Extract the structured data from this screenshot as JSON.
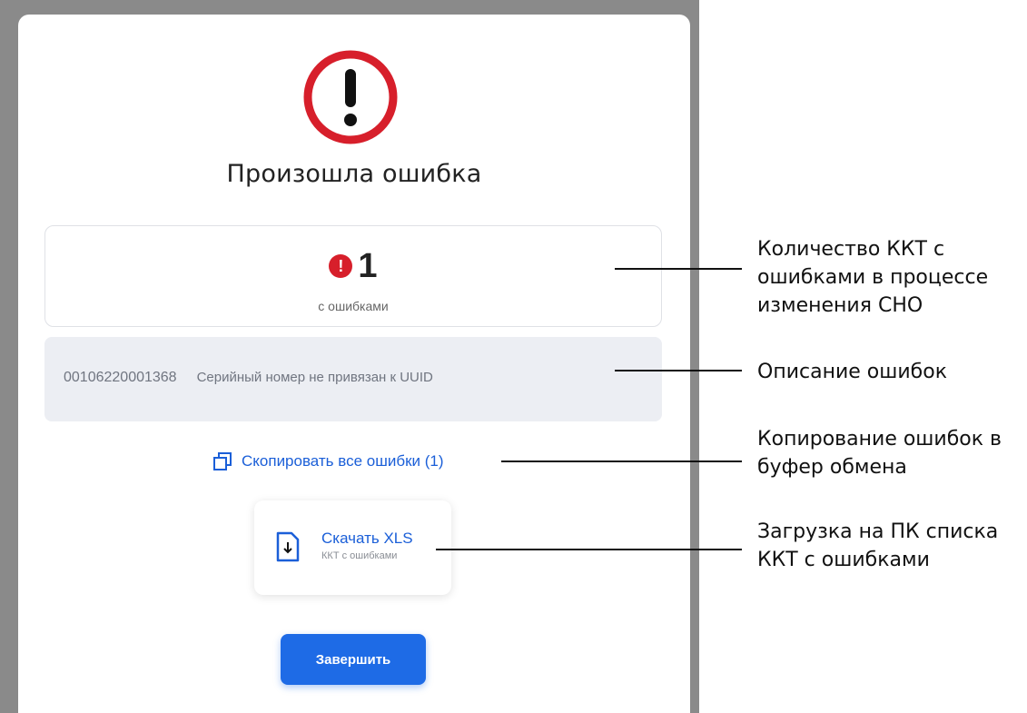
{
  "modal": {
    "title": "Произошла ошибка",
    "error_count": "1",
    "error_count_label": "с ошибками",
    "error_badge": "!",
    "errors": [
      {
        "serial": "00106220001368",
        "description": "Серийный номер не привязан к UUID"
      }
    ],
    "copy_label": "Скопировать все ошибки (1)",
    "download": {
      "title": "Скачать XLS",
      "subtitle": "ККТ с ошибками"
    },
    "finish_label": "Завершить"
  },
  "annotations": [
    {
      "lines": [
        "Количество ККТ с",
        "ошибками в процессе",
        "изменения СНО"
      ]
    },
    {
      "lines": [
        "Описание ошибок"
      ]
    },
    {
      "lines": [
        "Копирование ошибок в",
        "буфер обмена"
      ]
    },
    {
      "lines": [
        "Загрузка на ПК списка",
        "ККТ с ошибками"
      ]
    }
  ],
  "colors": {
    "accent": "#1e6be6",
    "link": "#1b5fd8",
    "error": "#d71f2b",
    "error_list_bg": "#eceef3",
    "backdrop": "#8a8a8a"
  },
  "icons": [
    "warning-circle-icon",
    "error-dot-icon",
    "copy-icon",
    "file-download-icon"
  ]
}
